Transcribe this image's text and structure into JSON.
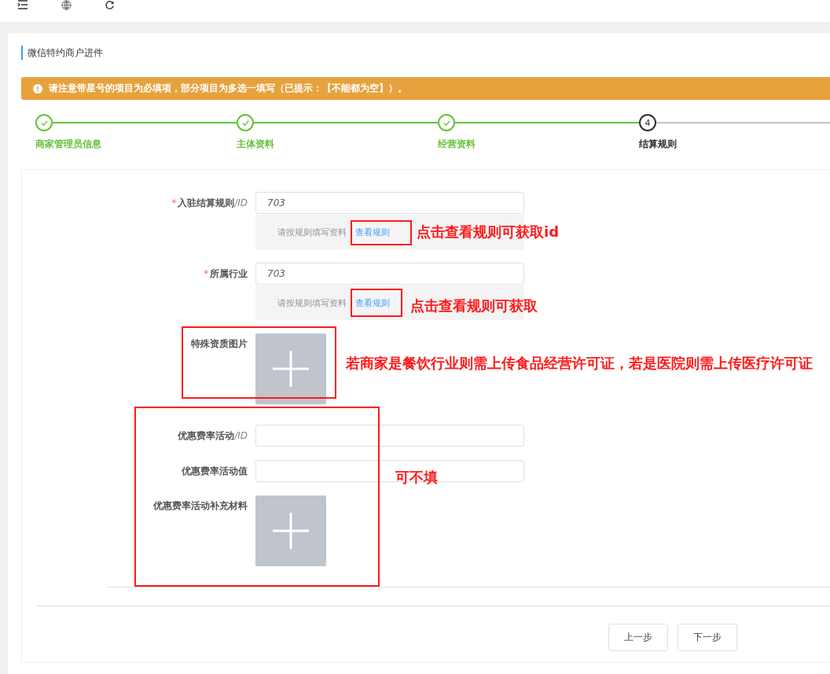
{
  "page_title": "微信特约商户进件",
  "alert": {
    "text": "请注意带星号的项目为必填项，部分项目为多选一填写（已提示：【不能都为空】）。"
  },
  "steps": [
    {
      "label": "商家管理员信息",
      "done": true
    },
    {
      "label": "主体资料",
      "done": true
    },
    {
      "label": "经营资料",
      "done": true
    },
    {
      "label": "结算规则",
      "number": "4",
      "done": false
    }
  ],
  "form": {
    "fields": [
      {
        "kind": "input",
        "label": "入驻结算规则",
        "label_suffix": "/ID",
        "required_mark": "*",
        "value": "703",
        "hint": "请按规则填写资料",
        "hint_link": "查看规则"
      },
      {
        "kind": "input",
        "label": "所属行业",
        "required_mark": "*",
        "value": "703",
        "hint": "请按规则填写资料",
        "hint_link": "查看规则"
      },
      {
        "kind": "upload",
        "label": "特殊资质图片"
      },
      {
        "kind": "input",
        "label": "优惠费率活动",
        "label_suffix": "/ID"
      },
      {
        "kind": "input",
        "label": "优惠费率活动值"
      },
      {
        "kind": "upload",
        "label": "优惠费率活动补充材料"
      }
    ]
  },
  "buttons": [
    "上一步",
    "下一步"
  ],
  "annotations": [
    {
      "text": "点击查看规则可获取id"
    },
    {
      "text": "点击查看规则可获取"
    },
    {
      "text": "若商家是餐饮行业则需上传食品经营许可证，若是医院则需上传医疗许可证"
    },
    {
      "text": "可不填"
    }
  ]
}
